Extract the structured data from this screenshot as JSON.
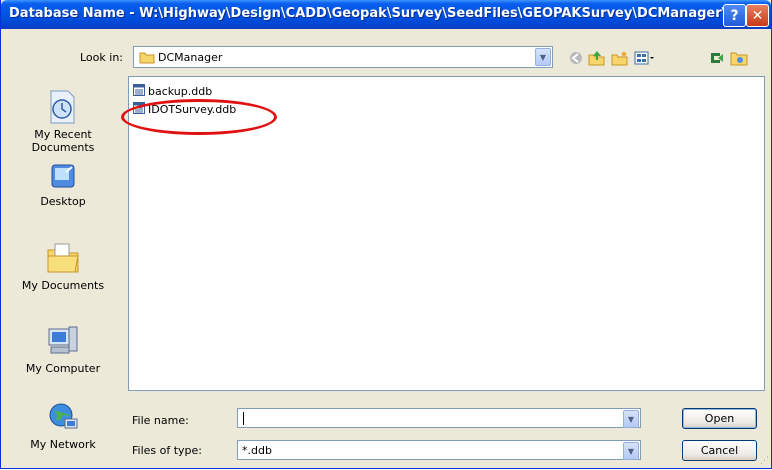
{
  "window": {
    "title": "Database Name - W:\\Highway\\Design\\CADD\\Geopak\\Survey\\SeedFiles\\GEOPAKSurvey\\DCManager\\",
    "help_label": "?",
    "close_label": "✕"
  },
  "lookin": {
    "label": "Look in:",
    "value": "DCManager",
    "folder_icon": "folder-icon"
  },
  "toolbar": {
    "icons": [
      "back-icon",
      "up-folder-icon",
      "new-folder-icon",
      "views-icon",
      "tools-icon",
      "icon"
    ]
  },
  "places": [
    {
      "label": "My Recent Documents",
      "icon": "recent-documents-icon"
    },
    {
      "label": "Desktop",
      "icon": "desktop-icon"
    },
    {
      "label": "My Documents",
      "icon": "my-documents-icon"
    },
    {
      "label": "My Computer",
      "icon": "my-computer-icon"
    },
    {
      "label": "My Network",
      "icon": "my-network-icon"
    }
  ],
  "files": [
    {
      "name": "backup.ddb",
      "icon": "database-file-icon"
    },
    {
      "name": "IDOTSurvey.ddb",
      "icon": "database-file-icon",
      "highlighted": true
    }
  ],
  "file_name": {
    "label": "File name:",
    "value": ""
  },
  "file_type": {
    "label": "Files of type:",
    "value": "*.ddb"
  },
  "buttons": {
    "open": "Open",
    "cancel": "Cancel"
  },
  "colors": {
    "titlebar": "#0054E3",
    "dialog_bg": "#ECE9D8",
    "annotation": "#E21111"
  }
}
